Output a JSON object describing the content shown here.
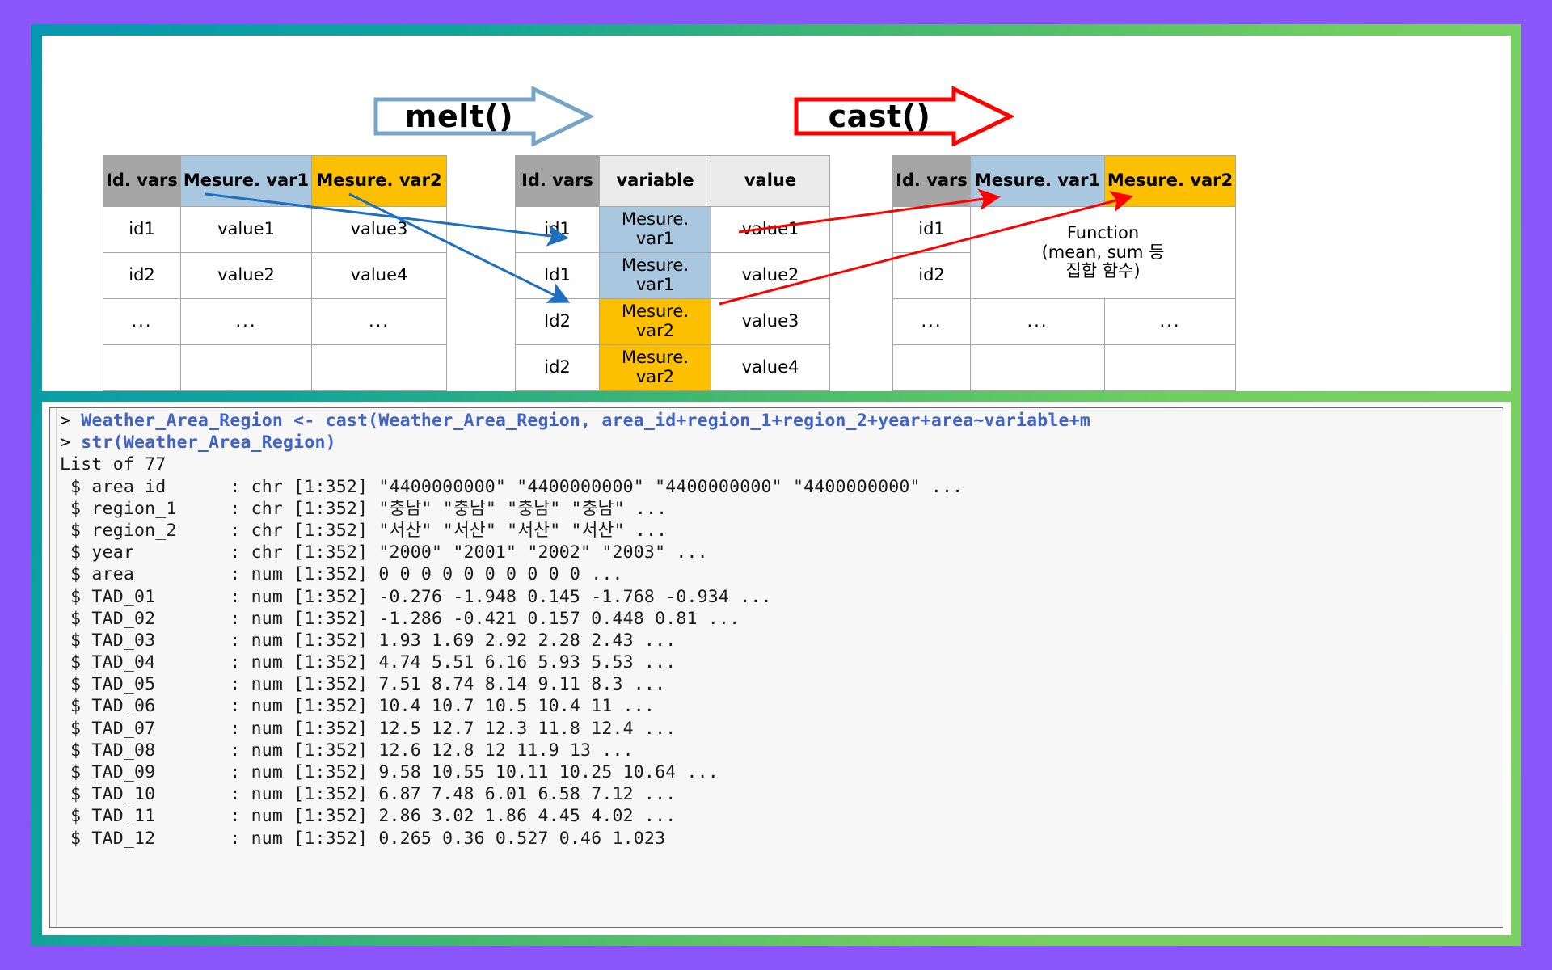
{
  "theme": {
    "background": "#8a55f9",
    "frame_gradient_start": "#0698b0",
    "frame_gradient_end": "#7cd165",
    "melt_arrow_color": "#76a5c8",
    "cast_arrow_color": "#ff0000",
    "melt_connector_color": "#1f6fc0",
    "cast_connector_color": "#ff0000",
    "header_id_bg": "#a6a6a6",
    "header_blue_bg": "#a9c7de",
    "header_gold_bg": "#fcc000",
    "header_grey_bg": "#ebebeb"
  },
  "diagram": {
    "melt_banner": {
      "label": "melt()"
    },
    "cast_banner": {
      "label": "cast()"
    },
    "source_table": {
      "headers": [
        "Id.\nvars",
        "Mesure.\nvar1",
        "Mesure.\nvar2"
      ],
      "rows": [
        [
          "id1",
          "value1",
          "value3"
        ],
        [
          "id2",
          "value2",
          "value4"
        ],
        [
          "...",
          "...",
          "..."
        ],
        [
          "",
          "",
          ""
        ],
        [
          "",
          "",
          ""
        ]
      ]
    },
    "melted_table": {
      "headers": [
        "Id.\nvars",
        "variable",
        "value"
      ],
      "rows": [
        [
          "id1",
          "Mesure.\nvar1",
          "value1"
        ],
        [
          "Id1",
          "Mesure.\nvar1",
          "value2"
        ],
        [
          "Id2",
          "Mesure.\nvar2",
          "value3"
        ],
        [
          "id2",
          "Mesure.\nvar2",
          "value4"
        ],
        [
          "...",
          "...",
          "..."
        ]
      ]
    },
    "cast_table": {
      "headers": [
        "Id.\nvars",
        "Mesure.\nvar1",
        "Mesure.\nvar2"
      ],
      "function_note": "Function\n(mean, sum 등\n집합 함수)",
      "rows": [
        [
          "id1",
          "",
          ""
        ],
        [
          "id2",
          "",
          ""
        ],
        [
          "...",
          "...",
          "..."
        ],
        [
          "",
          "",
          ""
        ],
        [
          "",
          "",
          ""
        ]
      ]
    }
  },
  "console": {
    "lines": [
      "> Weather_Area_Region <- cast(Weather_Area_Region, area_id+region_1+region_2+year+area~variable+m",
      "> str(Weather_Area_Region)",
      "List of 77",
      " $ area_id      : chr [1:352] \"4400000000\" \"4400000000\" \"4400000000\" \"4400000000\" ...",
      " $ region_1     : chr [1:352] \"충남\" \"충남\" \"충남\" \"충남\" ...",
      " $ region_2     : chr [1:352] \"서산\" \"서산\" \"서산\" \"서산\" ...",
      " $ year         : chr [1:352] \"2000\" \"2001\" \"2002\" \"2003\" ...",
      " $ area         : num [1:352] 0 0 0 0 0 0 0 0 0 0 ...",
      " $ TAD_01       : num [1:352] -0.276 -1.948 0.145 -1.768 -0.934 ...",
      " $ TAD_02       : num [1:352] -1.286 -0.421 0.157 0.448 0.81 ...",
      " $ TAD_03       : num [1:352] 1.93 1.69 2.92 2.28 2.43 ...",
      " $ TAD_04       : num [1:352] 4.74 5.51 6.16 5.93 5.53 ...",
      " $ TAD_05       : num [1:352] 7.51 8.74 8.14 9.11 8.3 ...",
      " $ TAD_06       : num [1:352] 10.4 10.7 10.5 10.4 11 ...",
      " $ TAD_07       : num [1:352] 12.5 12.7 12.3 11.8 12.4 ...",
      " $ TAD_08       : num [1:352] 12.6 12.8 12 11.9 13 ...",
      " $ TAD_09       : num [1:352] 9.58 10.55 10.11 10.25 10.64 ...",
      " $ TAD_10       : num [1:352] 6.87 7.48 6.01 6.58 7.12 ...",
      " $ TAD_11       : num [1:352] 2.86 3.02 1.86 4.45 4.02 ...",
      " $ TAD_12       : num [1:352] 0.265 0.36 0.527 0.46 1.023"
    ]
  }
}
